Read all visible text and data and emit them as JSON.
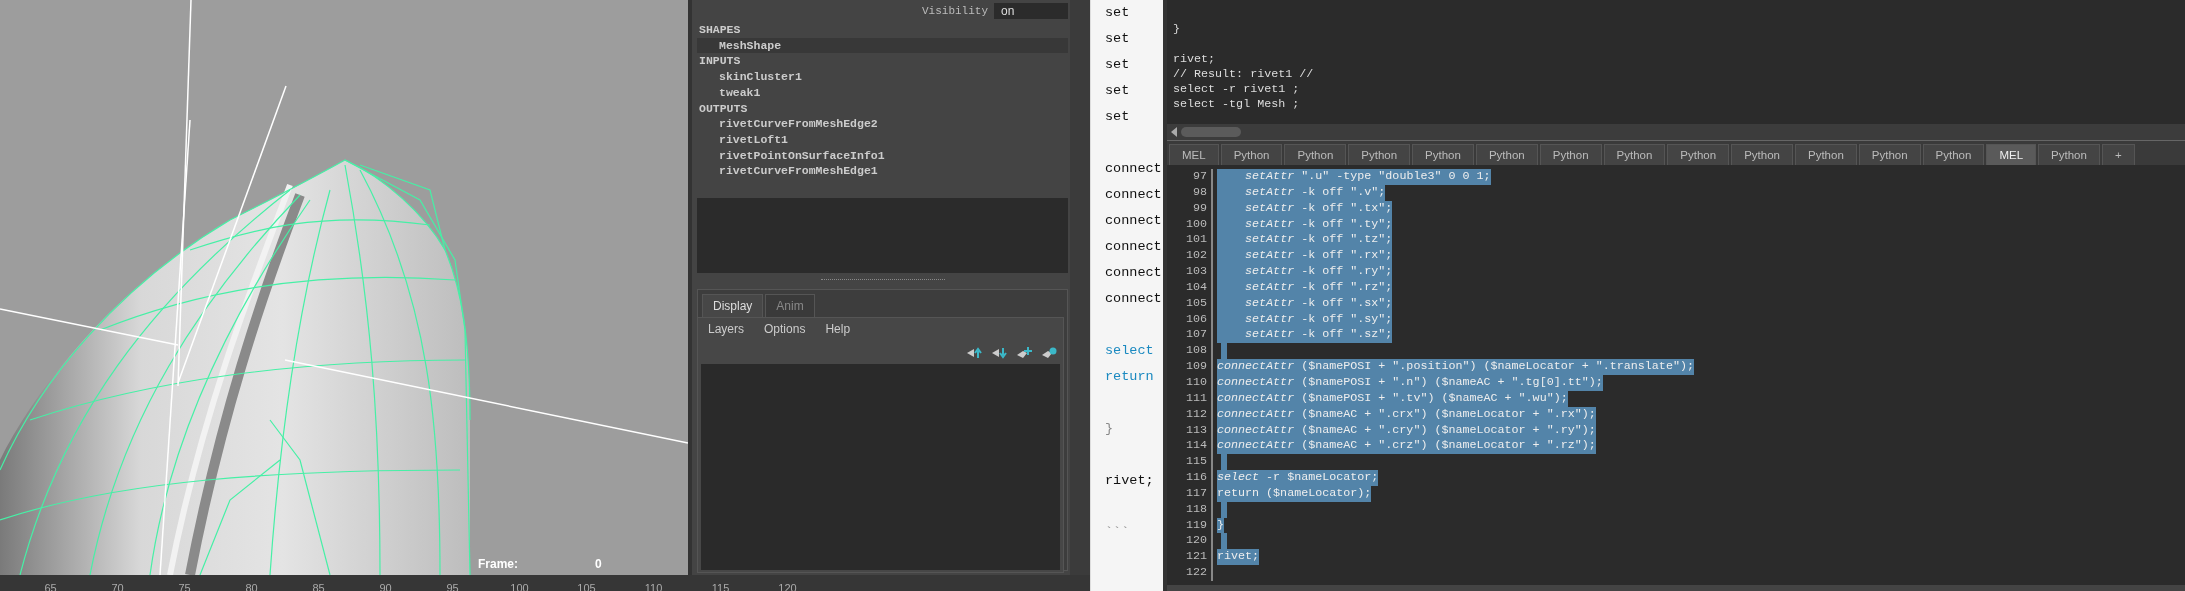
{
  "viewport": {
    "frame_label": "Frame:",
    "frame_value": "0"
  },
  "timeline": {
    "ticks": [
      "65",
      "70",
      "75",
      "80",
      "85",
      "90",
      "95",
      "100",
      "105",
      "110",
      "115",
      "120"
    ]
  },
  "attribute_editor": {
    "visibility": {
      "label": "Visibility",
      "value": "on"
    },
    "sections": [
      {
        "title": "SHAPES",
        "items": [
          {
            "label": "MeshShape",
            "selected": true
          }
        ]
      },
      {
        "title": "INPUTS",
        "items": [
          {
            "label": "skinCluster1",
            "selected": false
          },
          {
            "label": "tweak1",
            "selected": false
          }
        ]
      },
      {
        "title": "OUTPUTS",
        "items": [
          {
            "label": "rivetCurveFromMeshEdge2",
            "selected": false
          },
          {
            "label": "rivetLoft1",
            "selected": false
          },
          {
            "label": "rivetPointOnSurfaceInfo1",
            "selected": false
          },
          {
            "label": "rivetCurveFromMeshEdge1",
            "selected": false
          }
        ]
      }
    ]
  },
  "layer_editor": {
    "tabs": [
      {
        "label": "Display",
        "selected": true
      },
      {
        "label": "Anim",
        "selected": false
      }
    ],
    "menu": [
      "Layers",
      "Options",
      "Help"
    ]
  },
  "article_code": {
    "lines": [
      {
        "kind": "plain",
        "text": "set"
      },
      {
        "kind": "plain",
        "text": "set"
      },
      {
        "kind": "plain",
        "text": "set"
      },
      {
        "kind": "plain",
        "text": "set"
      },
      {
        "kind": "plain",
        "text": "set"
      },
      {
        "kind": "blank"
      },
      {
        "kind": "plain",
        "text": "connect"
      },
      {
        "kind": "plain",
        "text": "connect"
      },
      {
        "kind": "plain",
        "text": "connect"
      },
      {
        "kind": "plain",
        "text": "connect"
      },
      {
        "kind": "plain",
        "text": "connect"
      },
      {
        "kind": "plain",
        "text": "connect"
      },
      {
        "kind": "blank"
      },
      {
        "kind": "keyword",
        "text": "select"
      },
      {
        "kind": "keyword",
        "text": "return"
      },
      {
        "kind": "blank"
      },
      {
        "kind": "brace",
        "text": "}"
      },
      {
        "kind": "blank"
      },
      {
        "kind": "plain",
        "text": "rivet;"
      },
      {
        "kind": "blank"
      },
      {
        "kind": "fence",
        "text": "```"
      }
    ]
  },
  "script_editor": {
    "output_lines": [
      {
        "kind": "text",
        "text": "}"
      },
      {
        "kind": "blank"
      },
      {
        "kind": "text",
        "text": "rivet;"
      },
      {
        "kind": "text",
        "text": "// Result: rivet1 //"
      },
      {
        "kind": "text",
        "text": "select -r rivet1 ;"
      },
      {
        "kind": "text",
        "text": "select -tgl Mesh ;"
      }
    ],
    "tabs": [
      {
        "label": "MEL",
        "selected": false
      },
      {
        "label": "Python",
        "selected": false
      },
      {
        "label": "Python",
        "selected": false
      },
      {
        "label": "Python",
        "selected": false
      },
      {
        "label": "Python",
        "selected": false
      },
      {
        "label": "Python",
        "selected": false
      },
      {
        "label": "Python",
        "selected": false
      },
      {
        "label": "Python",
        "selected": false
      },
      {
        "label": "Python",
        "selected": false
      },
      {
        "label": "Python",
        "selected": false
      },
      {
        "label": "Python",
        "selected": false
      },
      {
        "label": "Python",
        "selected": false
      },
      {
        "label": "Python",
        "selected": false
      },
      {
        "label": "MEL",
        "selected": true
      },
      {
        "label": "Python",
        "selected": false
      },
      {
        "label": "+",
        "selected": false
      }
    ],
    "lines": [
      {
        "number": "97",
        "text": "    *setAttr* \".u\" -type \"double3\" 0 0 1;",
        "selected": true
      },
      {
        "number": "98",
        "text": "    *setAttr* -k off \".v\";",
        "selected": true
      },
      {
        "number": "99",
        "text": "    *setAttr* -k off \".tx\";",
        "selected": true
      },
      {
        "number": "100",
        "text": "    *setAttr* -k off \".ty\";",
        "selected": true
      },
      {
        "number": "101",
        "text": "    *setAttr* -k off \".tz\";",
        "selected": true
      },
      {
        "number": "102",
        "text": "    *setAttr* -k off \".rx\";",
        "selected": true
      },
      {
        "number": "103",
        "text": "    *setAttr* -k off \".ry\";",
        "selected": true
      },
      {
        "number": "104",
        "text": "    *setAttr* -k off \".rz\";",
        "selected": true
      },
      {
        "number": "105",
        "text": "    *setAttr* -k off \".sx\";",
        "selected": true
      },
      {
        "number": "106",
        "text": "    *setAttr* -k off \".sy\";",
        "selected": true
      },
      {
        "number": "107",
        "text": "    *setAttr* -k off \".sz\";",
        "selected": true
      },
      {
        "number": "108",
        "selected": true
      },
      {
        "number": "109",
        "text": "*connectAttr* ($namePOSI + \".position\") ($nameLocator + \".translate\");",
        "selected": true
      },
      {
        "number": "110",
        "text": "*connectAttr* ($namePOSI + \".n\") ($nameAC + \".tg[0].tt\");",
        "selected": true
      },
      {
        "number": "111",
        "text": "*connectAttr* ($namePOSI + \".tv\") ($nameAC + \".wu\");",
        "selected": true
      },
      {
        "number": "112",
        "text": "*connectAttr* ($nameAC + \".crx\") ($nameLocator + \".rx\");",
        "selected": true
      },
      {
        "number": "113",
        "text": "*connectAttr* ($nameAC + \".cry\") ($nameLocator + \".ry\");",
        "selected": true
      },
      {
        "number": "114",
        "text": "*connectAttr* ($nameAC + \".crz\") ($nameLocator + \".rz\");",
        "selected": true
      },
      {
        "number": "115",
        "selected": true
      },
      {
        "number": "116",
        "text": "*select* -r $nameLocator;",
        "selected": true
      },
      {
        "number": "117",
        "text": "return ($nameLocator);",
        "selected": true
      },
      {
        "number": "118",
        "selected": true
      },
      {
        "number": "119",
        "text": "}",
        "selected": true
      },
      {
        "number": "120",
        "selected": true
      },
      {
        "number": "121",
        "text": "rivet;",
        "selected": true
      },
      {
        "number": "122",
        "selected": false
      }
    ]
  }
}
